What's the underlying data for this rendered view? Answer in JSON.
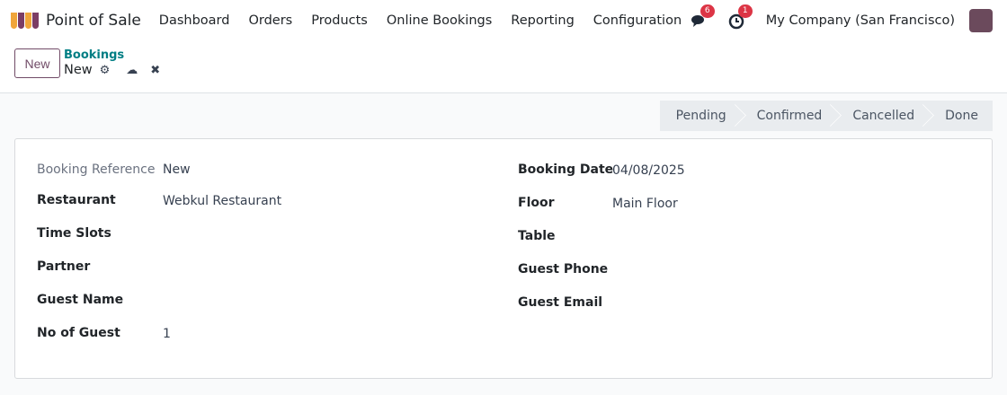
{
  "nav": {
    "app": "Point of Sale",
    "menu": [
      "Dashboard",
      "Orders",
      "Products",
      "Online Bookings",
      "Reporting",
      "Configuration"
    ],
    "messages_count": "6",
    "activities_count": "1",
    "company": "My Company (San Francisco)"
  },
  "control": {
    "new_label": "New",
    "breadcrumb": "Bookings",
    "current": "New"
  },
  "statusbar": [
    "Pending",
    "Confirmed",
    "Cancelled",
    "Done"
  ],
  "form": {
    "left": [
      {
        "label": "Booking Reference",
        "value": "New"
      },
      {
        "label": "Restaurant",
        "value": "Webkul Restaurant"
      },
      {
        "label": "Time Slots",
        "value": ""
      },
      {
        "label": "Partner",
        "value": ""
      },
      {
        "label": "Guest Name",
        "value": ""
      },
      {
        "label": "No of Guest",
        "value": "1"
      }
    ],
    "right": [
      {
        "label": "Booking Date",
        "value": "04/08/2025"
      },
      {
        "label": "Floor",
        "value": "Main Floor"
      },
      {
        "label": "Table",
        "value": ""
      },
      {
        "label": "Guest Phone",
        "value": ""
      },
      {
        "label": "Guest Email",
        "value": ""
      }
    ]
  }
}
